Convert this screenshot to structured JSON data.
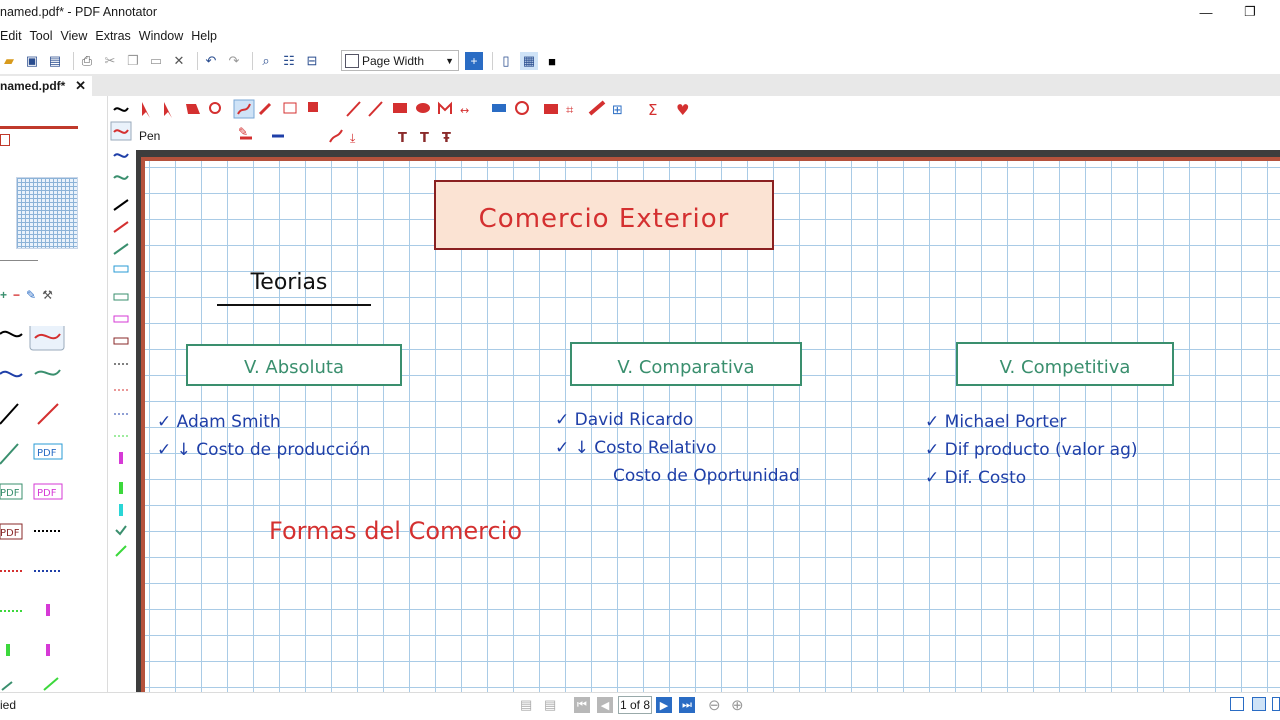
{
  "window": {
    "title": "named.pdf* - PDF Annotator",
    "minimize": "—",
    "restore": "❐"
  },
  "menu": [
    "Edit",
    "Tool",
    "View",
    "Extras",
    "Window",
    "Help"
  ],
  "toolbar": {
    "zoom_value": "Page Width"
  },
  "tab": {
    "label": "named.pdf*",
    "close": "✕"
  },
  "tool": {
    "name": "Pen"
  },
  "colors": {
    "accent": "#2e7d32",
    "page_border": "#b5523c",
    "grid": "#a9cbe6",
    "red_ink": "#d43030",
    "blue_ink": "#1f3fa8",
    "teal_box": "#3a8f6e"
  },
  "note": {
    "title": "Comercio Exterior",
    "heading": "Teorias",
    "boxes": [
      {
        "label": "V. Absoluta"
      },
      {
        "label": "V. Comparativa"
      },
      {
        "label": "V. Competitiva"
      }
    ],
    "col1": [
      "✓ Adam Smith",
      "✓ ↓ Costo de producción"
    ],
    "col2": [
      "✓ David Ricardo",
      "✓ ↓ Costo Relativo",
      "Costo de Oportunidad"
    ],
    "col3": [
      "✓ Michael Porter",
      "✓ Dif producto (valor ag)",
      "✓ Dif. Costo"
    ],
    "bottom": "Formas del Comercio"
  },
  "status": {
    "left": "ied",
    "page": "1 of 8"
  }
}
